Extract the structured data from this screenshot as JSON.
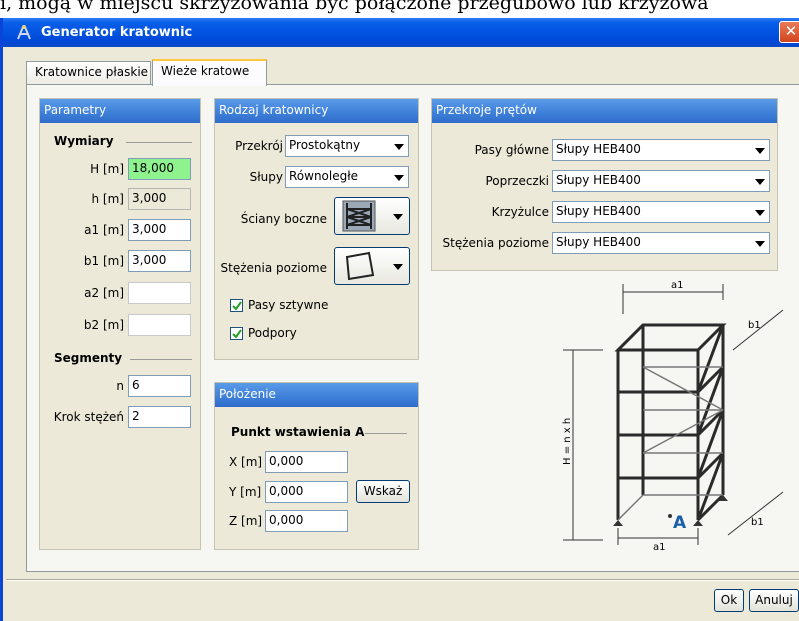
{
  "background_text": "i, mogą w miejscu skrzyżowania być połączone przegubowo lub krzyżowa",
  "window": {
    "title": "Generator kratownic",
    "close_label": "✕"
  },
  "tabs": [
    {
      "label": "Kratownice płaskie"
    },
    {
      "label": "Wieże kratowe"
    }
  ],
  "parametry": {
    "title": "Parametry",
    "wymiary_label": "Wymiary",
    "H_label": "H [m]",
    "H_value": "18,000",
    "h_label": "h [m]",
    "h_value": "3,000",
    "a1_label": "a1 [m]",
    "a1_value": "3,000",
    "b1_label": "b1 [m]",
    "b1_value": "3,000",
    "a2_label": "a2 [m]",
    "a2_value": "",
    "b2_label": "b2 [m]",
    "b2_value": "",
    "segmenty_label": "Segmenty",
    "n_label": "n",
    "n_value": "6",
    "krok_label": "Krok stężeń",
    "krok_value": "2"
  },
  "rodzaj": {
    "title": "Rodzaj kratownicy",
    "przekroj_label": "Przekrój",
    "przekroj_value": "Prostokątny",
    "slupy_label": "Słupy",
    "slupy_value": "Równoległe",
    "sciany_label": "Ściany boczne",
    "stezenia_label": "Stężenia poziome",
    "pasy_sztywne_label": "Pasy sztywne",
    "pasy_sztywne_checked": true,
    "podpory_label": "Podpory",
    "podpory_checked": true
  },
  "polozenie": {
    "title": "Położenie",
    "punkt_label": "Punkt wstawienia A",
    "x_label": "X [m]",
    "x_value": "0,000",
    "y_label": "Y [m]",
    "y_value": "0,000",
    "z_label": "Z [m]",
    "z_value": "0,000",
    "wskaz_label": "Wskaż"
  },
  "przekroje": {
    "title": "Przekroje prętów",
    "pasy_glowne_label": "Pasy główne",
    "pasy_glowne_value": "Słupy HEB400",
    "poprzeczki_label": "Poprzeczki",
    "poprzeczki_value": "Słupy HEB400",
    "krzyzulce_label": "Krzyżulce",
    "krzyzulce_value": "Słupy HEB400",
    "stezenia_label": "Stężenia poziome",
    "stezenia_value": "Słupy HEB400"
  },
  "diagram": {
    "a1_top": "a1",
    "b1_top": "b1",
    "height_label": "H = n x h",
    "point_label": "A",
    "b1_bottom": "b1",
    "a1_bottom": "a1"
  },
  "footer": {
    "ok_label": "Ok",
    "cancel_label": "Anuluj"
  }
}
